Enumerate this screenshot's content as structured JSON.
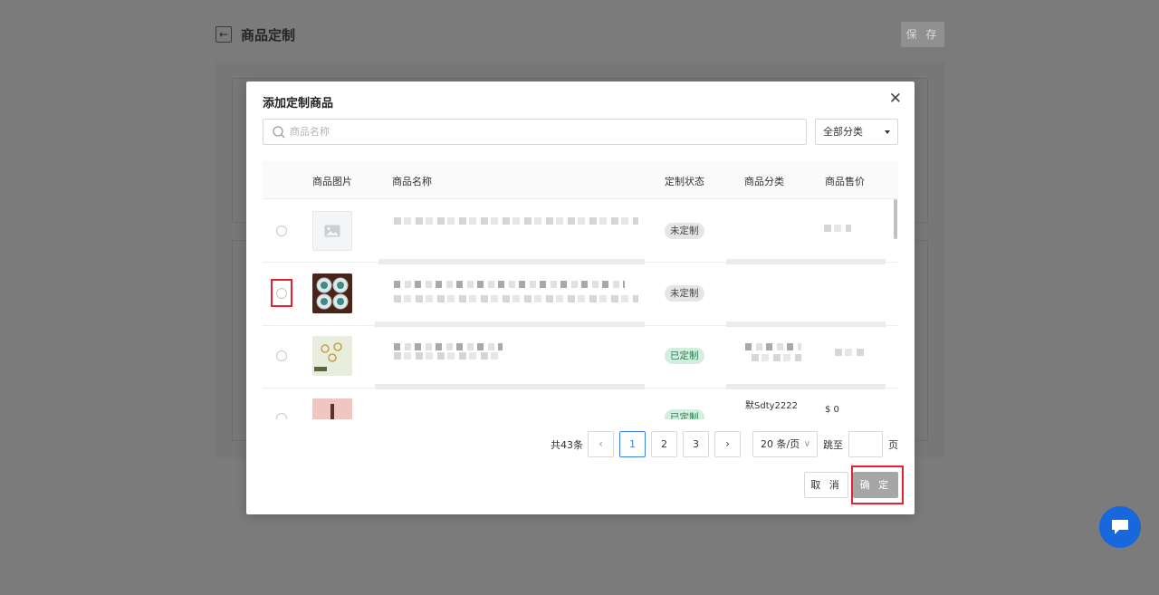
{
  "page": {
    "title": "商品定制",
    "save_label": "保 存"
  },
  "modal": {
    "title": "添加定制商品",
    "search_placeholder": "商品名称",
    "category_value": "全部分类",
    "columns": [
      "商品图片",
      "商品名称",
      "定制状态",
      "商品分类",
      "商品售价"
    ],
    "rows": [
      {
        "image": "placeholder-image",
        "status": "未定制"
      },
      {
        "image": "product-photo",
        "status": "未定制"
      },
      {
        "image": "product-photo",
        "status": "已定制"
      },
      {
        "image": "product-photo",
        "status": "已定制",
        "category_partial": "默Sdty2222",
        "price_partial": "$ 0"
      }
    ],
    "pagination": {
      "total": "共43条",
      "prev_icon": "‹",
      "next_icon": "›",
      "pages": [
        "1",
        "2",
        "3"
      ],
      "current_page": "1",
      "page_size": "20 条/页",
      "page_size_icon": "∨",
      "jump_label": "跳至",
      "page_suffix": "页"
    },
    "cancel_label": "取 消",
    "confirm_label": "确 定"
  },
  "colors": {
    "accent": "#3d7fea",
    "highlight": "#e5232d",
    "chat": "#1668dc",
    "customized": "#2a7c4f"
  }
}
